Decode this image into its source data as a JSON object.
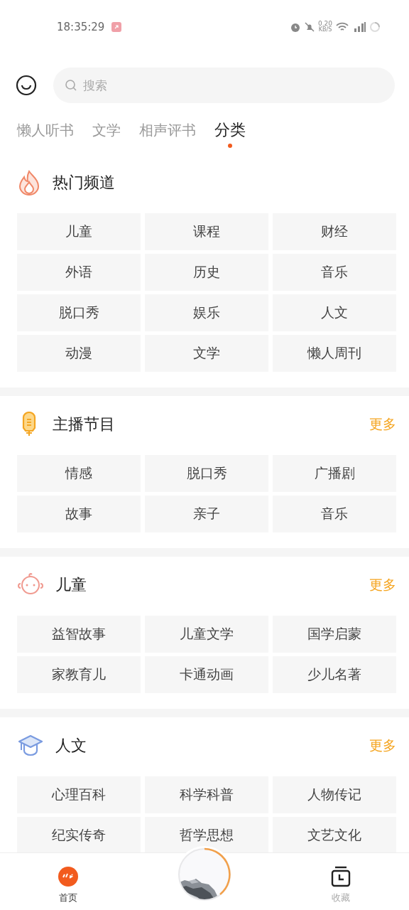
{
  "status_bar": {
    "time": "18:35:29",
    "speed": "0.20",
    "speed_unit": "KB/S"
  },
  "search": {
    "placeholder": "搜索"
  },
  "tabs": [
    {
      "label": "懒人听书",
      "selected": false
    },
    {
      "label": "文学",
      "selected": false
    },
    {
      "label": "相声评书",
      "selected": false
    },
    {
      "label": "分类",
      "selected": true
    }
  ],
  "sections": [
    {
      "kind": "fire",
      "title": "热门频道",
      "items": [
        "儿童",
        "课程",
        "财经",
        "外语",
        "历史",
        "音乐",
        "脱口秀",
        "娱乐",
        "人文",
        "动漫",
        "文学",
        "懒人周刊"
      ]
    },
    {
      "kind": "mic",
      "title": "主播节目",
      "more": "更多",
      "items": [
        "情感",
        "脱口秀",
        "广播剧",
        "故事",
        "亲子",
        "音乐"
      ]
    },
    {
      "kind": "baby",
      "title": "儿童",
      "more": "更多",
      "items": [
        "益智故事",
        "儿童文学",
        "国学启蒙",
        "家教育儿",
        "卡通动画",
        "少儿名著"
      ]
    },
    {
      "kind": "cap",
      "title": "人文",
      "more": "更多",
      "items": [
        "心理百科",
        "科学科普",
        "人物传记",
        "纪实传奇",
        "哲学思想",
        "文艺文化"
      ]
    }
  ],
  "bottom_nav": [
    {
      "kind": "home",
      "label": "首页",
      "selected": true
    },
    {
      "kind": "player"
    },
    {
      "kind": "favorites",
      "label": "收藏",
      "selected": false
    }
  ]
}
